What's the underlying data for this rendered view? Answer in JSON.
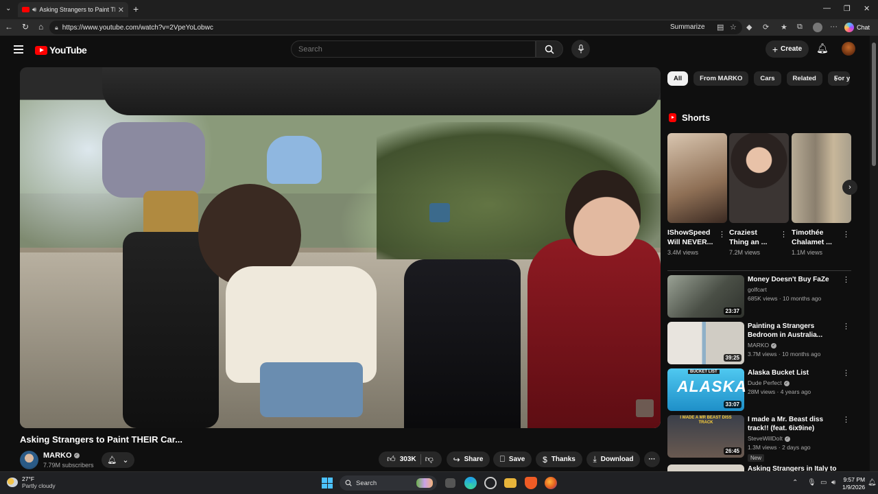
{
  "browser": {
    "tab_title": "Asking Strangers to Paint THEI",
    "tab_close": "✕",
    "new_tab": "+",
    "url": "https://www.youtube.com/watch?v=2VpeYoLobwc",
    "summarize_label": "Summarize",
    "chat_label": "Chat"
  },
  "yt": {
    "logo_text": "YouTube",
    "search_placeholder": "Search",
    "create_label": "Create"
  },
  "video": {
    "title": "Asking Strangers to Paint THEIR Car...",
    "channel_name": "MARKO",
    "subscribers": "7.79M subscribers",
    "likes": "303K",
    "share_label": "Share",
    "save_label": "Save",
    "thanks_label": "Thanks",
    "download_label": "Download",
    "more_label": "···"
  },
  "chips": [
    "All",
    "From MARKO",
    "Cars",
    "Related",
    "For y"
  ],
  "shorts": {
    "header": "Shorts",
    "items": [
      {
        "title": "IShowSpeed Will NEVER...",
        "views": "3.4M views",
        "color": "#b9a48c"
      },
      {
        "title": "Craziest Thing an ...",
        "views": "7.2M views",
        "color": "#3b3533"
      },
      {
        "title": "Timothée Chalamet ...",
        "views": "1.1M views",
        "color": "#8a7f6e"
      }
    ]
  },
  "recommendations": [
    {
      "title": "Money Doesn't Buy FaZe",
      "channel": "golfcart",
      "meta": "685K views · 10 months ago",
      "duration": "23:37",
      "color": "#6a6f66"
    },
    {
      "title": "Painting a Strangers Bedroom in Australia...",
      "channel": "MARKO",
      "meta": "3.7M views · 10 months ago",
      "duration": "39:25",
      "color": "#c9c4bc"
    },
    {
      "title": "Alaska Bucket List",
      "channel": "Dude Perfect",
      "meta": "28M views · 4 years ago",
      "duration": "33:07",
      "color": "#29b6e8"
    },
    {
      "title": "I made a Mr. Beast diss track!! (feat. 6ix9ine)",
      "channel": "SteveWillDoIt",
      "meta": "1.3M views · 2 days ago",
      "duration": "26:45",
      "badge": "New",
      "color": "#5a5550"
    },
    {
      "title": "Asking Strangers in Italy to",
      "color": "#d8d2c8"
    }
  ],
  "thumb_texts": {
    "alaska_top": "BUCKET LIST",
    "alaska_main": "ALASKA",
    "diss": "I MADE A MR BEAST DISS TRACK"
  },
  "taskbar": {
    "temp": "27°F",
    "weather": "Partly cloudy",
    "search_label": "Search",
    "time": "9:57 PM",
    "date": "1/9/2026"
  }
}
